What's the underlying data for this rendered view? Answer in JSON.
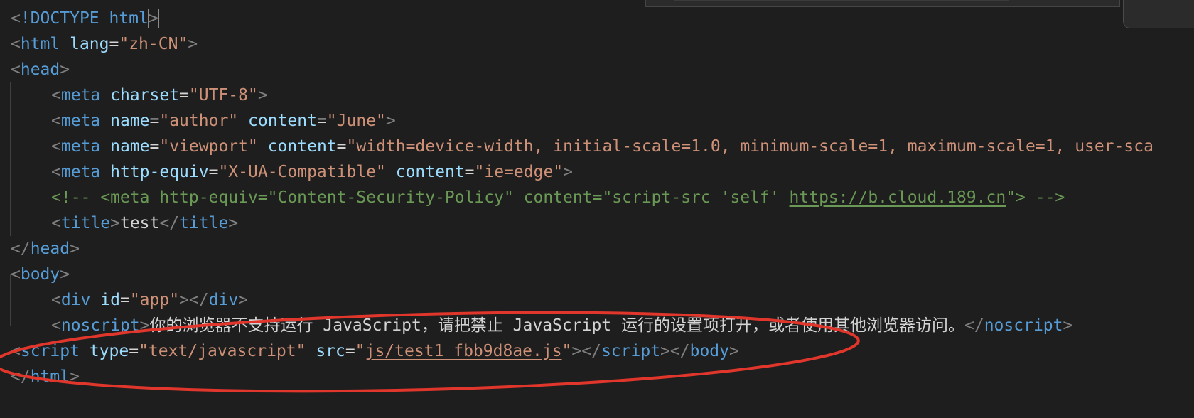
{
  "editor": {
    "lines": [
      {
        "doctype_open": "<",
        "doctype_text": "!DOCTYPE html",
        "doctype_close": ">"
      },
      {
        "tag": "html",
        "attr": "lang",
        "value": "\"zh-CN\""
      },
      {
        "tag": "head"
      },
      {
        "tag": "meta",
        "attr": "charset",
        "value": "\"UTF-8\""
      },
      {
        "tag": "meta",
        "attr1": "name",
        "value1": "\"author\"",
        "attr2": "content",
        "value2": "\"June\""
      },
      {
        "tag": "meta",
        "attr1": "name",
        "value1": "\"viewport\"",
        "attr2": "content",
        "value2": "\"width=device-width, initial-scale=1.0, minimum-scale=1, maximum-scale=1, user-sca"
      },
      {
        "tag": "meta",
        "attr1": "http-equiv",
        "value1": "\"X-UA-Compatible\"",
        "attr2": "content",
        "value2": "\"ie=edge\""
      },
      {
        "comment_pre": "<!-- <meta http-equiv=\"Content-Security-Policy\" content=\"script-src 'self' ",
        "comment_link": "https://b.cloud.189.cn",
        "comment_post": "\"> -->"
      },
      {
        "tag": "title",
        "text": "test",
        "close": "title"
      },
      {
        "close": "head"
      },
      {
        "tag": "body"
      },
      {
        "tag": "div",
        "attr": "id",
        "value": "\"app\"",
        "close": "div"
      },
      {
        "tag": "noscript",
        "text": "你的浏览器不支持运行 JavaScript，请把禁止 JavaScript 运行的设置项打开，或者使用其他浏览器访问。",
        "close": "noscript"
      },
      {
        "tag": "script",
        "attr1": "type",
        "value1": "\"text/javascript\"",
        "attr2": "src",
        "value2_q1": "\"",
        "value2_link": "js/test1_fbb9d8ae.js",
        "value2_q2": "\"",
        "close1": "script",
        "close2": "body"
      },
      {
        "close": "html"
      }
    ]
  },
  "annotation": {
    "color": "#e0362b"
  },
  "colors": {
    "background": "#1e1e1e",
    "tag_bracket": "#808080",
    "tag_name": "#569cd6",
    "attribute": "#9cdcfe",
    "string": "#ce9178",
    "comment": "#6a9955"
  }
}
